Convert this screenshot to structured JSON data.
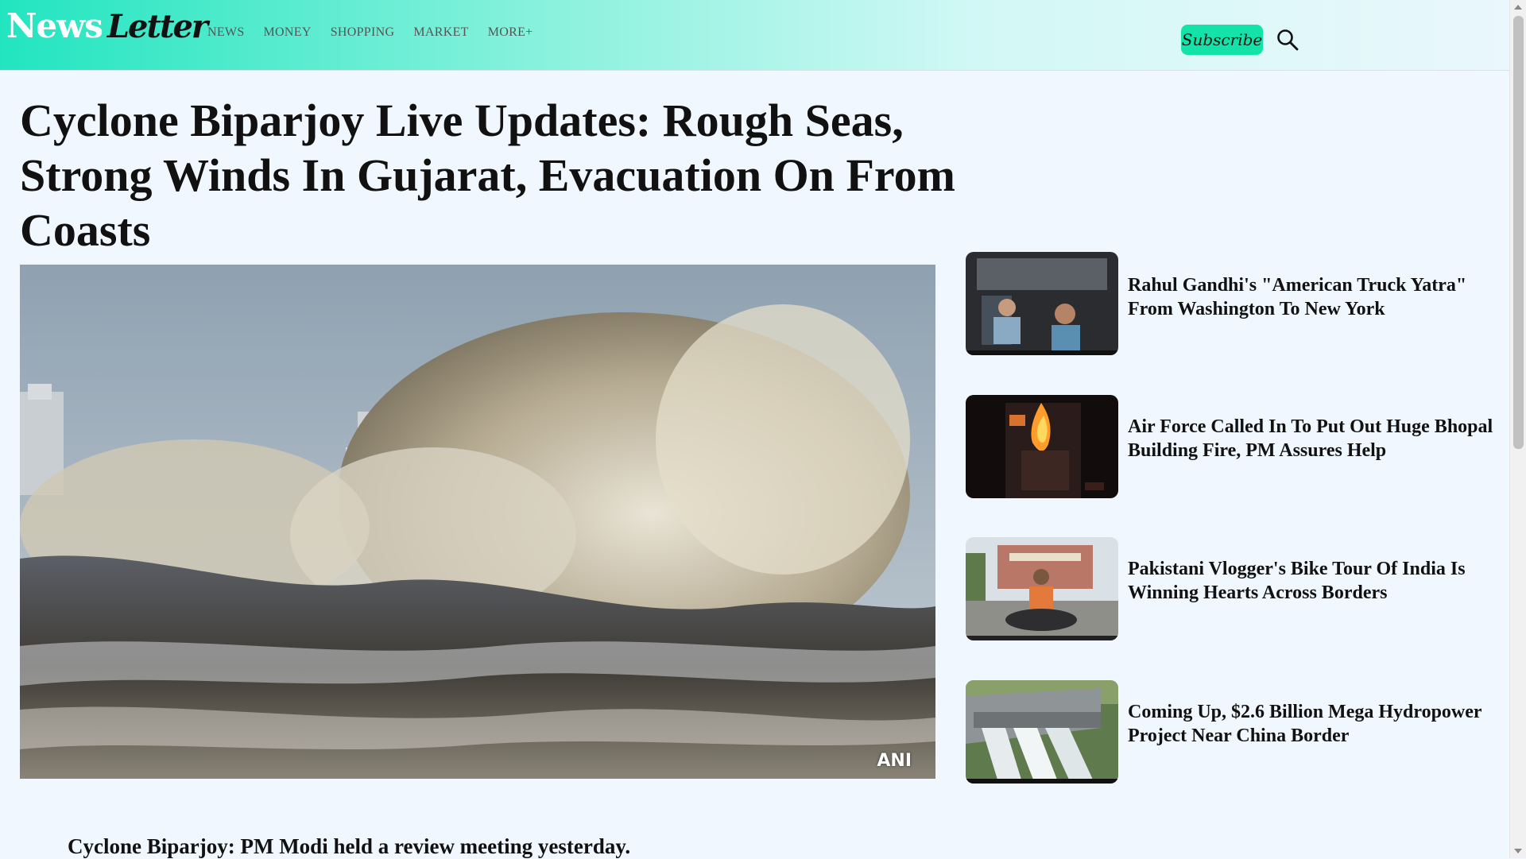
{
  "brand": {
    "news": "News",
    "letter": "Letter"
  },
  "nav": [
    "NEWS",
    "MONEY",
    "SHOPPING",
    "MARKET",
    "MORE+"
  ],
  "header": {
    "subscribe_label": "Subscribe",
    "search_icon": "search-icon"
  },
  "article": {
    "headline": "Cyclone Biparjoy Live Updates: Rough Seas, Strong Winds In Gujarat, Evacuation On From Coasts",
    "image_credit": "ANI",
    "caption": "Cyclone Biparjoy: PM Modi held a review meeting yesterday."
  },
  "sidebar": {
    "stories": [
      {
        "title": "Rahul Gandhi's \"American Truck Yatra\" From Washington To New York"
      },
      {
        "title": "Air Force Called In To Put Out Huge Bhopal Building Fire, PM Assures Help"
      },
      {
        "title": "Pakistani Vlogger's Bike Tour Of India Is Winning Hearts Across Borders"
      },
      {
        "title": "Coming Up, $2.6 Billion Mega Hydropower Project Near China Border"
      }
    ]
  },
  "colors": {
    "header_start": "#22e5c0",
    "subscribe_bg": "#14e3a9",
    "page_bg": "#f0f7ff"
  }
}
